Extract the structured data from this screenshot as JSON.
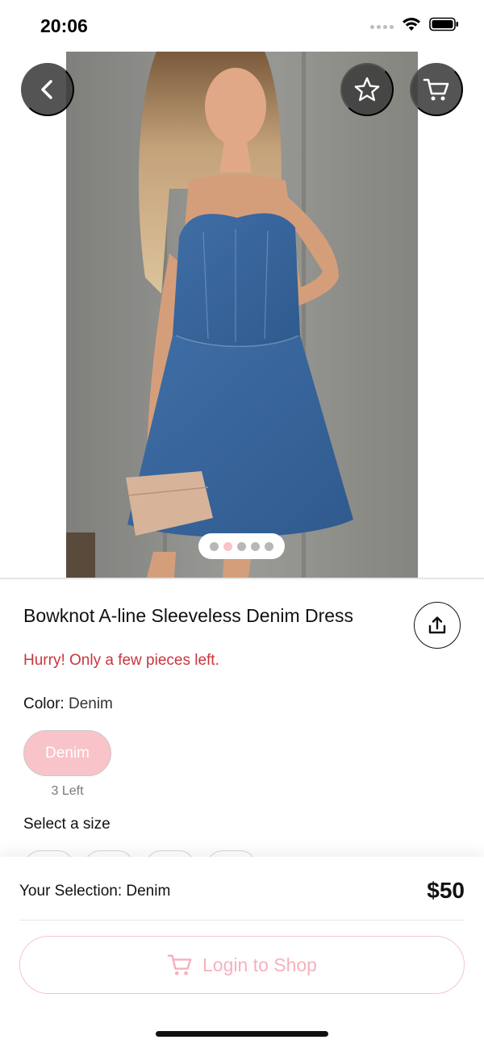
{
  "status_bar": {
    "time": "20:06"
  },
  "product": {
    "title": "Bowknot A-line Sleeveless Denim Dress",
    "stock_alert": "Hurry! Only a few pieces left.",
    "color_label": "Color:",
    "color_value": "Denim",
    "swatch_label": "Denim",
    "swatch_stock": "3 Left",
    "size_label": "Select a size",
    "image_count": 5,
    "active_image_index": 1
  },
  "colors": {
    "accent_pink": "#f8c3c9",
    "alert_red": "#c9363d",
    "overlay_button": "#3c3c3c"
  },
  "icons": {
    "back": "chevron-left-icon",
    "favorite": "star-icon",
    "cart": "cart-icon",
    "share": "share-icon"
  },
  "checkout": {
    "selection_label": "Your Selection:",
    "selection_value": "Denim",
    "price": "$50",
    "login_button": "Login to Shop"
  }
}
